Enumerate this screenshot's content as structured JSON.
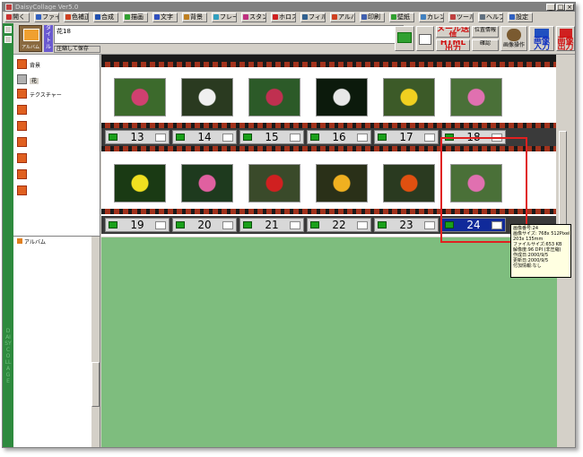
{
  "window": {
    "title": "DaisyCollage  Ver5.0"
  },
  "toolbar": {
    "items": [
      {
        "label": "開く",
        "color": "#cc3030"
      },
      {
        "label": "ファイル",
        "color": "#3060c0"
      },
      {
        "label": "色補正",
        "color": "#d04020"
      },
      {
        "label": "合成",
        "color": "#2050b0"
      },
      {
        "label": "描画",
        "color": "#30a030"
      },
      {
        "label": "文字",
        "color": "#3050c0"
      },
      {
        "label": "背景",
        "color": "#c08020"
      },
      {
        "label": "フレーム",
        "color": "#30a0c0"
      },
      {
        "label": "スタンプ",
        "color": "#c03080"
      },
      {
        "label": "ホロスコープ",
        "color": "#d02020"
      },
      {
        "label": "フィルタ",
        "color": "#306090"
      },
      {
        "label": "アルバム",
        "color": "#d04020"
      },
      {
        "label": "印刷",
        "color": "#4060b0"
      },
      {
        "label": "壁紙",
        "color": "#30a030"
      },
      {
        "label": "カレンダー",
        "color": "#4080c0"
      },
      {
        "label": "ツール",
        "color": "#c04040"
      },
      {
        "label": "ヘルプ",
        "color": "#607080"
      },
      {
        "label": "設定",
        "color": "#3060c0"
      }
    ]
  },
  "title_panel": {
    "logo_caption": "アルバム",
    "tag_label": "タイトル",
    "title_value": "花18",
    "compress_button": "圧縮して保存",
    "right_buttons": {
      "mail": "メール送信",
      "html": "HTML出力",
      "position": "位置情報",
      "confirm": "確認",
      "image_ops": "画像操作",
      "image_input": "画像入力",
      "image_output": "画像出力"
    }
  },
  "sidebar": {
    "categories": [
      {
        "label": "背景"
      },
      {
        "label": "花"
      },
      {
        "label": "テクスチャー"
      },
      {
        "label": ""
      },
      {
        "label": ""
      },
      {
        "label": ""
      },
      {
        "label": ""
      },
      {
        "label": ""
      },
      {
        "label": ""
      }
    ],
    "album_label": "アルバム"
  },
  "left_strip_text": "DAISY COLLAGE",
  "film": {
    "row1_numbers": [
      "13",
      "14",
      "15",
      "16",
      "17",
      "18"
    ],
    "row2_numbers": [
      "19",
      "20",
      "21",
      "22",
      "23",
      "24"
    ],
    "selected": "24",
    "row1_photos": [
      {
        "bg": "#3c6a2c",
        "flower": "#d04070"
      },
      {
        "bg": "#2a3a20",
        "flower": "#f0f0f0"
      },
      {
        "bg": "#2c5a28",
        "flower": "#c03050"
      },
      {
        "bg": "#0c1a0c",
        "flower": "#e8e8e8"
      },
      {
        "bg": "#3c5a28",
        "flower": "#f0d020"
      },
      {
        "bg": "#4a7038",
        "flower": "#e070b0"
      }
    ],
    "row2_photos": [
      {
        "bg": "#1a3a14",
        "flower": "#f0e020"
      },
      {
        "bg": "#1e3a1e",
        "flower": "#e060a0"
      },
      {
        "bg": "#3a4a2a",
        "flower": "#d02020"
      },
      {
        "bg": "#2a3018",
        "flower": "#f0b020"
      },
      {
        "bg": "#2a3a20",
        "flower": "#e05010"
      },
      {
        "bg": "#4a7038",
        "flower": "#e070b0"
      }
    ]
  },
  "tooltip": {
    "lines": [
      "画像番号:24",
      "画像サイズ: 768x 512Pixel",
      "              203x 135mm",
      "ファイルサイズ:653 KB",
      "解像度:96 DPI (非圧縮)",
      "作成日:2000/9/5",
      "更新日:2000/9/5",
      "付加情報:なし"
    ]
  }
}
